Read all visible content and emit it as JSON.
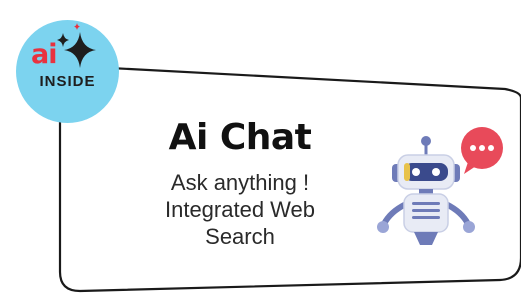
{
  "badge": {
    "ai_text": "ai",
    "inside_text": "INSIDE",
    "circle_color": "#7cd3ef",
    "ai_color": "#e8323f"
  },
  "card": {
    "title": "Ai Chat",
    "lines": [
      "Ask anything !",
      "Integrated Web",
      "Search"
    ]
  },
  "illustration": {
    "robot_icon": "robot-icon",
    "chat_bubble_icon": "chat-bubble-icon",
    "bubble_color": "#e84a5a"
  }
}
